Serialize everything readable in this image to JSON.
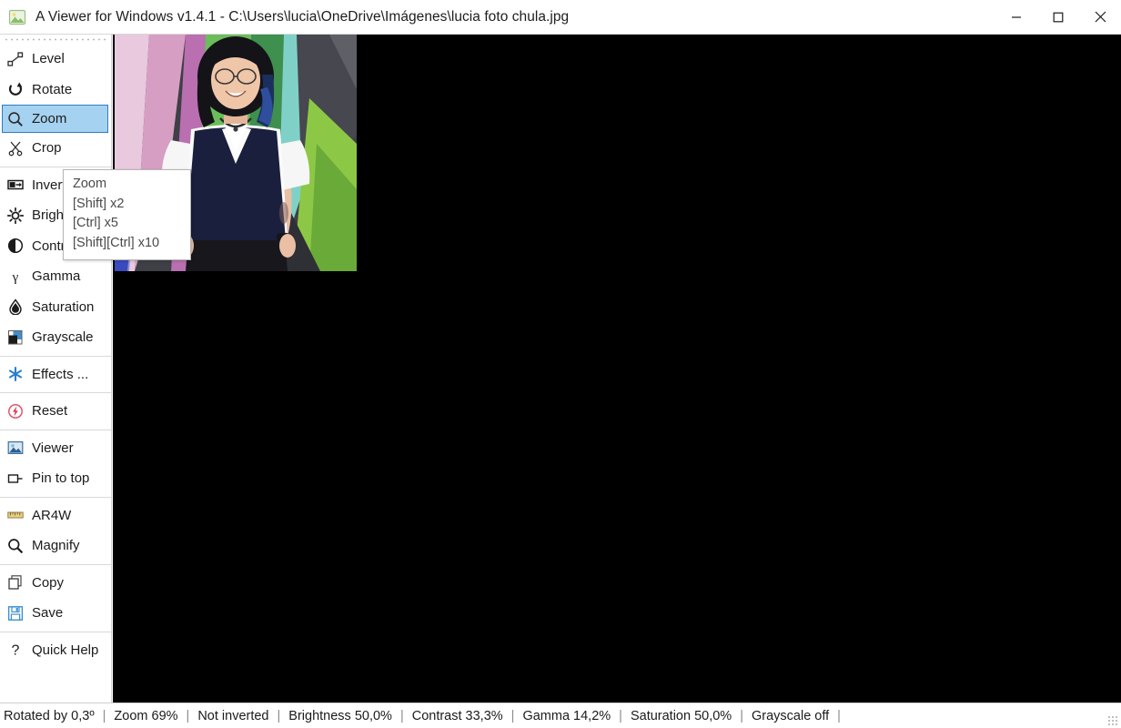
{
  "window": {
    "title": "A Viewer for Windows v1.4.1 - C:\\Users\\lucia\\OneDrive\\Imágenes\\lucia foto chula.jpg",
    "app_icon": "picture-icon",
    "controls": {
      "minimize_label": "—",
      "maximize_label": "□",
      "close_label": "✕"
    }
  },
  "sidebar": {
    "groups": [
      {
        "items": [
          {
            "label": "Level",
            "icon": "level-icon",
            "selected": false
          },
          {
            "label": "Rotate",
            "icon": "rotate-icon",
            "selected": false
          },
          {
            "label": "Zoom",
            "icon": "magnifier-icon",
            "selected": true
          },
          {
            "label": "Crop",
            "icon": "scissors-icon",
            "selected": false
          }
        ]
      },
      {
        "items": [
          {
            "label": "Invert",
            "icon": "invert-icon",
            "selected": false
          },
          {
            "label": "Brightness",
            "icon": "sun-icon",
            "selected": false
          },
          {
            "label": "Contrast",
            "icon": "contrast-icon",
            "selected": false
          },
          {
            "label": "Gamma",
            "icon": "gamma-icon",
            "selected": false
          },
          {
            "label": "Saturation",
            "icon": "droplet-icon",
            "selected": false
          },
          {
            "label": "Grayscale",
            "icon": "grayscale-icon",
            "selected": false
          }
        ]
      },
      {
        "items": [
          {
            "label": "Effects ...",
            "icon": "asterisk-icon",
            "selected": false
          }
        ]
      },
      {
        "items": [
          {
            "label": "Reset",
            "icon": "reset-icon",
            "selected": false
          }
        ]
      },
      {
        "items": [
          {
            "label": "Viewer",
            "icon": "viewer-icon",
            "selected": false
          },
          {
            "label": "Pin to top",
            "icon": "pin-icon",
            "selected": false
          }
        ]
      },
      {
        "items": [
          {
            "label": "AR4W",
            "icon": "ruler-icon",
            "selected": false
          },
          {
            "label": "Magnify",
            "icon": "magnifier-icon",
            "selected": false
          }
        ]
      },
      {
        "items": [
          {
            "label": "Copy",
            "icon": "copy-icon",
            "selected": false
          },
          {
            "label": "Save",
            "icon": "floppy-icon",
            "selected": false
          }
        ]
      },
      {
        "items": [
          {
            "label": "Quick Help",
            "icon": "question-icon",
            "selected": false
          }
        ]
      }
    ]
  },
  "tooltip": {
    "title": "Zoom",
    "line1": "[Shift] x2",
    "line2": "[Ctrl] x5",
    "line3": "[Shift][Ctrl] x10"
  },
  "canvas": {
    "background_color": "#000000",
    "image_alt": "photo of a person standing in front of a geometric multicolour wall"
  },
  "statusbar": {
    "rotation": "Rotated by 0,3º",
    "zoom": "Zoom 69%",
    "inverted": "Not inverted",
    "brightness": "Brightness 50,0%",
    "contrast": "Contrast 33,3%",
    "gamma": "Gamma 14,2%",
    "saturation": "Saturation 50,0%",
    "grayscale": "Grayscale off",
    "separator": "|"
  },
  "colors": {
    "selection_fill": "#a5d2f0",
    "selection_border": "#2f7cc2",
    "accent_blue": "#2a7fc9",
    "reset_red": "#e0536f",
    "canvas_black": "#000000"
  }
}
